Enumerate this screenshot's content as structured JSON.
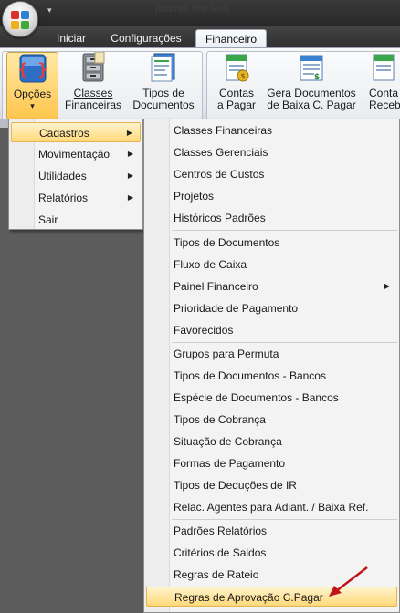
{
  "window": {
    "blurred_title": "[blurred title text]"
  },
  "tabs": [
    {
      "label": "Iniciar"
    },
    {
      "label": "Configurações"
    },
    {
      "label": "Financeiro"
    }
  ],
  "ribbon": {
    "buttons": [
      {
        "line1": "Opções",
        "line2": ""
      },
      {
        "line1": "Classes",
        "line2": "Financeiras"
      },
      {
        "line1": "Tipos de",
        "line2": "Documentos"
      },
      {
        "line1": "Contas",
        "line2": "a Pagar"
      },
      {
        "line1": "Gera Documentos",
        "line2": "de Baixa C. Pagar"
      },
      {
        "line1": "Conta",
        "line2": "Receb"
      }
    ],
    "opcoes_dropdown_glyph": "▾"
  },
  "options_menu": {
    "items": [
      {
        "label": "Cadastros",
        "submenu": true
      },
      {
        "label": "Movimentação",
        "submenu": true
      },
      {
        "label": "Utilidades",
        "submenu": true
      },
      {
        "label": "Relatórios",
        "submenu": true
      },
      {
        "label": "Sair",
        "submenu": false
      }
    ]
  },
  "cadastros_submenu": {
    "items": [
      {
        "label": "Classes Financeiras"
      },
      {
        "label": "Classes Gerenciais"
      },
      {
        "label": "Centros de Custos"
      },
      {
        "label": "Projetos"
      },
      {
        "label": "Históricos Padrões"
      },
      {
        "label": "Tipos de Documentos"
      },
      {
        "label": "Fluxo de Caixa"
      },
      {
        "label": "Painel Financeiro"
      },
      {
        "label": "Prioridade de Pagamento"
      },
      {
        "label": "Favorecidos"
      },
      {
        "label": "Grupos para Permuta"
      },
      {
        "label": "Tipos de Documentos - Bancos"
      },
      {
        "label": "Espécie de Documentos - Bancos"
      },
      {
        "label": "Tipos de Cobrança"
      },
      {
        "label": "Situação de Cobrança"
      },
      {
        "label": "Formas de Pagamento"
      },
      {
        "label": "Tipos de Deduções de IR"
      },
      {
        "label": "Relac. Agentes para Adiant. / Baixa Ref."
      },
      {
        "label": "Padrões Relatórios"
      },
      {
        "label": "Critérios de Saldos"
      },
      {
        "label": "Regras de Rateio"
      },
      {
        "label": "Regras de Aprovação C.Pagar"
      }
    ]
  },
  "glyphs": {
    "submenu_arrow": "▶",
    "qat_arrow": "▾"
  },
  "colors": {
    "highlight_top": "#fff4cc",
    "highlight_bottom": "#ffd97a",
    "annotation_arrow": "#c0141a"
  }
}
